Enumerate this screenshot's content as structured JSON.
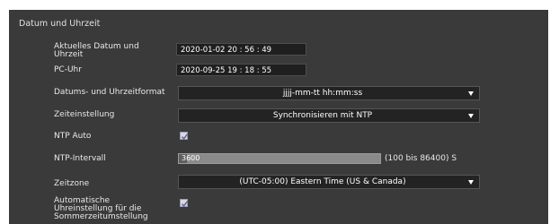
{
  "section": {
    "title": "Datum und Uhrzeit"
  },
  "fields": {
    "current_datetime": {
      "label": "Aktuelles Datum und Uhrzeit",
      "value": "2020-01-02 20 : 56 : 49"
    },
    "pc_clock": {
      "label": "PC-Uhr",
      "value": "2020-09-25 19 : 18 : 55"
    },
    "datetime_format": {
      "label": "Datums- und Uhrzeitformat",
      "selected": "jjjj-mm-tt hh:mm:ss"
    },
    "time_setting": {
      "label": "Zeiteinstellung",
      "selected": "Synchronisieren mit NTP"
    },
    "ntp_auto": {
      "label": "NTP Auto",
      "checked": true
    },
    "ntp_interval": {
      "label": "NTP-Intervall",
      "value": "3600",
      "range_text": "(100 bis 86400) S",
      "min": 100,
      "max": 86400,
      "current": 3600
    },
    "timezone": {
      "label": "Zeitzone",
      "selected": "(UTC-05:00) Eastern Time (US & Canada)"
    },
    "auto_dst": {
      "label": "Automatische Uhreinstellung für die Sommerzeitumstellung",
      "checked": true
    }
  }
}
